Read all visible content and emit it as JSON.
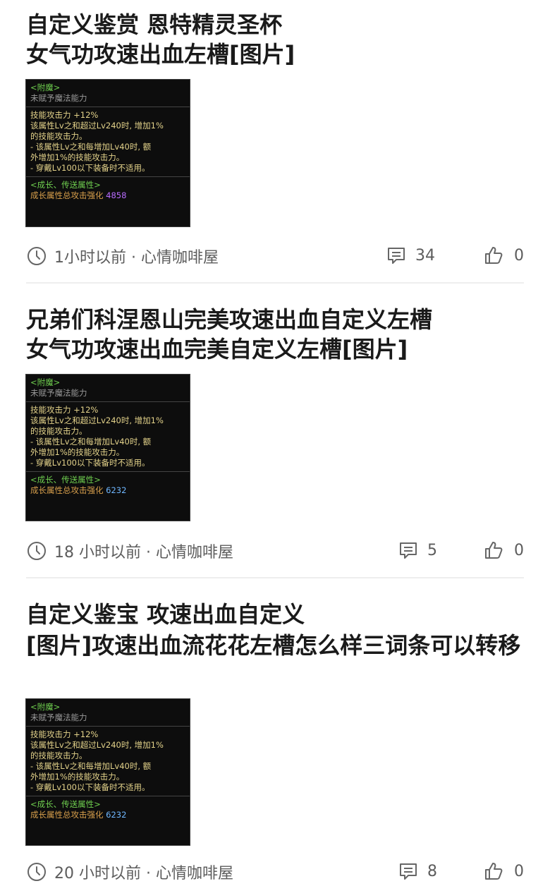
{
  "posts": [
    {
      "title_lines": [
        "自定义鉴赏 恩特精灵圣杯",
        "女气功攻速出血左槽[图片]"
      ],
      "thumb": {
        "enchant_header": "<附魔>",
        "enchant_none": "未赋予魔法能力",
        "skill_line1": "技能攻击力 +12%",
        "skill_line2": "该属性Lv之和超过Lv240时, 增加1%",
        "skill_line3": "的技能攻击力。",
        "skill_line4": "- 该属性Lv之和每增加Lv40时, 额",
        "skill_line5": "外增加1%的技能攻击力。",
        "skill_line6": "- 穿戴Lv100以下装备时不适用。",
        "growth_header": "<成长、传送属性>",
        "growth_label": "成长属性总攻击强化",
        "growth_value": "4858"
      },
      "time": "1小时以前 · 心情咖啡屋",
      "comments": "34",
      "likes": "0"
    },
    {
      "title_lines": [
        "兄弟们科涅恩山完美攻速出血自定义左槽",
        "女气功攻速出血完美自定义左槽[图片]"
      ],
      "thumb": {
        "enchant_header": "<附魔>",
        "enchant_none": "未赋予魔法能力",
        "skill_line1": "技能攻击力 +12%",
        "skill_line2": "该属性Lv之和超过Lv240时, 增加1%",
        "skill_line3": "的技能攻击力。",
        "skill_line4": "- 该属性Lv之和每增加Lv40时, 额",
        "skill_line5": "外增加1%的技能攻击力。",
        "skill_line6": "- 穿戴Lv100以下装备时不适用。",
        "growth_header": "<成长、传送属性>",
        "growth_label": "成长属性总攻击强化",
        "growth_value": "6232"
      },
      "time": "18 小时以前 · 心情咖啡屋",
      "comments": "5",
      "likes": "0"
    },
    {
      "title_lines": [
        "自定义鉴宝 攻速出血自定义",
        "[图片]攻速出血流花花左槽怎么样三词条可以转移"
      ],
      "thumb": {
        "enchant_header": "<附魔>",
        "enchant_none": "未赋予魔法能力",
        "skill_line1": "技能攻击力 +12%",
        "skill_line2": "该属性Lv之和超过Lv240时, 增加1%",
        "skill_line3": "的技能攻击力。",
        "skill_line4": "- 该属性Lv之和每增加Lv40时, 额",
        "skill_line5": "外增加1%的技能攻击力。",
        "skill_line6": "- 穿戴Lv100以下装备时不适用。",
        "growth_header": "<成长、传送属性>",
        "growth_label": "成长属性总攻击强化",
        "growth_value": "6232"
      },
      "time": "20 小时以前 · 心情咖啡屋",
      "comments": "8",
      "likes": "0"
    }
  ],
  "icons": {
    "clock": "clock-icon",
    "comment": "comment-icon",
    "like": "thumbs-up-icon"
  }
}
